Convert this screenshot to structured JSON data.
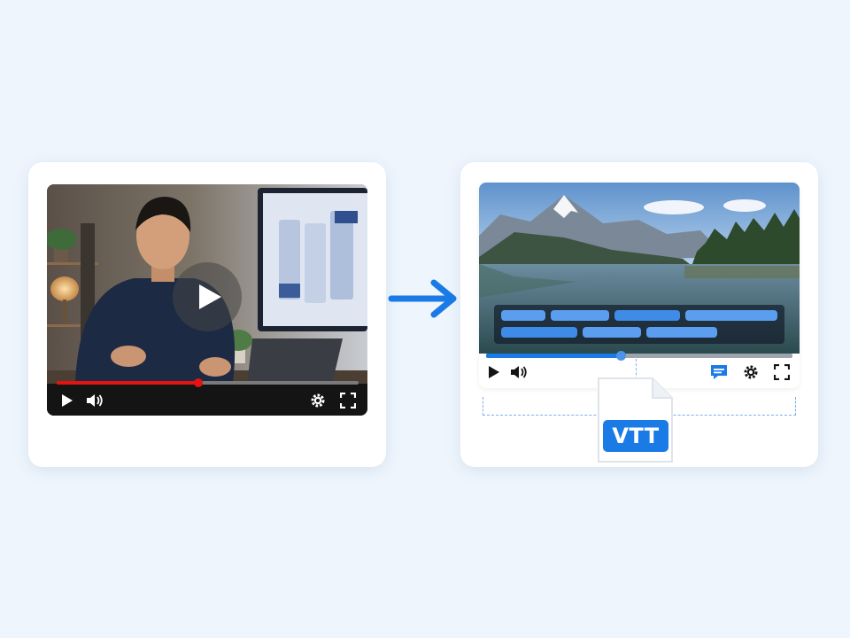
{
  "left_player": {
    "progress": 0.47,
    "icons": [
      "play-icon",
      "volume-icon",
      "settings-gear-icon",
      "fullscreen-icon",
      "center-play-icon"
    ],
    "colors": {
      "progress": "#e51212",
      "track": "#7a7a7a",
      "bar": "#141414"
    }
  },
  "arrow": {
    "color": "#1b7be6"
  },
  "right_player": {
    "progress": 0.44,
    "icons": [
      "play-icon",
      "volume-icon",
      "captions-icon",
      "settings-gear-icon",
      "fullscreen-icon"
    ],
    "colors": {
      "progress": "#1b7be6",
      "captions_icon": "#1b7be6"
    }
  },
  "vtt_file": {
    "label": "VTT",
    "color": "#1b7be6"
  }
}
